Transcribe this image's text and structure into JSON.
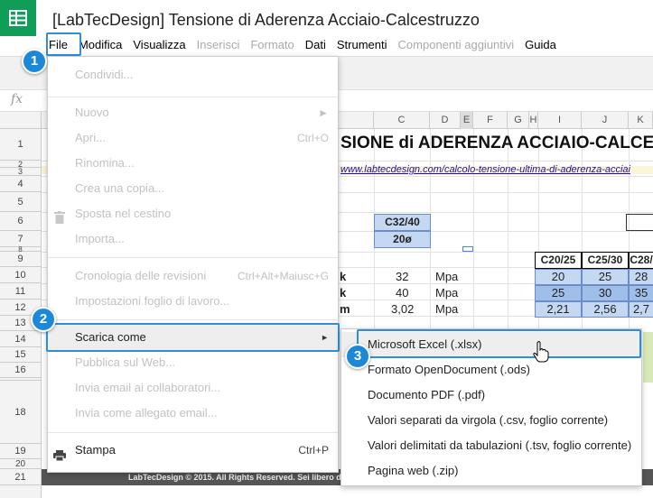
{
  "app": {
    "title": "[LabTecDesign] Tensione di Aderenza Acciaio-Calcestruzzo",
    "logo_icon": "sheets-grid-icon",
    "brand_color": "#0f9d58"
  },
  "menubar": {
    "items": [
      {
        "label": "File",
        "enabled": true
      },
      {
        "label": "Modifica",
        "enabled": true
      },
      {
        "label": "Visualizza",
        "enabled": true
      },
      {
        "label": "Inserisci",
        "enabled": false
      },
      {
        "label": "Formato",
        "enabled": false
      },
      {
        "label": "Dati",
        "enabled": true
      },
      {
        "label": "Strumenti",
        "enabled": true
      },
      {
        "label": "Componenti aggiuntivi",
        "enabled": false
      },
      {
        "label": "Guida",
        "enabled": true
      }
    ]
  },
  "formula_bar": {
    "icon_text": "fx"
  },
  "grid": {
    "columns": [
      "C",
      "D",
      "E",
      "F",
      "G",
      "H",
      "I",
      "J",
      "K"
    ],
    "rows": [
      "1",
      "2",
      "3",
      "4",
      "5",
      "6",
      "7",
      "8",
      "9",
      "10",
      "11",
      "12",
      "13",
      "14",
      "15",
      "16",
      "17",
      "18",
      "19",
      "20",
      "21"
    ],
    "heading": "SIONE di ADERENZA ACCIAIO-CALCES",
    "link": "www.labtecdesign.com/calcolo-tensione-ultima-di-aderenza-acciai",
    "concrete_class": "C32/40",
    "bar_diameter": "20ø",
    "param_rows": [
      {
        "label": "k",
        "value": "32",
        "unit": "Mpa"
      },
      {
        "label": "k",
        "value": "40",
        "unit": "Mpa"
      },
      {
        "label": "m",
        "value": "3,02",
        "unit": "Mpa"
      }
    ],
    "table_headers": [
      "C20/25",
      "C25/30",
      "C28/"
    ],
    "table_rows": [
      [
        "20",
        "25",
        "28"
      ],
      [
        "25",
        "30",
        "35"
      ],
      [
        "2,21",
        "2,56",
        "2,7"
      ]
    ],
    "footer_text": "LabTecDesign © 2015. All Rights Reserved. Sei libero di"
  },
  "file_menu": {
    "items": [
      {
        "label": "Condividi...",
        "shortcut": "",
        "enabled": false
      },
      {
        "label": "Nuovo",
        "shortcut": "►",
        "enabled": false
      },
      {
        "label": "Apri...",
        "shortcut": "Ctrl+O",
        "enabled": false
      },
      {
        "label": "Rinomina...",
        "shortcut": "",
        "enabled": false
      },
      {
        "label": "Crea una copia...",
        "shortcut": "",
        "enabled": false
      },
      {
        "label": "Sposta nel cestino",
        "shortcut": "",
        "enabled": false,
        "icon": "trash-icon"
      },
      {
        "label": "Importa...",
        "shortcut": "",
        "enabled": false
      },
      {
        "label": "Cronologia delle revisioni",
        "shortcut": "Ctrl+Alt+Maiusc+G",
        "enabled": false
      },
      {
        "label": "Impostazioni foglio di lavoro...",
        "shortcut": "",
        "enabled": false
      },
      {
        "label": "Scarica come",
        "shortcut": "►",
        "enabled": true
      },
      {
        "label": "Pubblica sul Web...",
        "shortcut": "",
        "enabled": false
      },
      {
        "label": "Invia email ai collaboratori...",
        "shortcut": "",
        "enabled": false
      },
      {
        "label": "Invia come allegato email...",
        "shortcut": "",
        "enabled": false
      },
      {
        "label": "Stampa",
        "shortcut": "Ctrl+P",
        "enabled": true,
        "icon": "printer-icon"
      }
    ]
  },
  "download_submenu": {
    "items": [
      "Microsoft Excel (.xlsx)",
      "Formato OpenDocument (.ods)",
      "Documento PDF (.pdf)",
      "Valori separati da virgola (.csv, foglio corrente)",
      "Valori delimitati da tabulazioni (.tsv, foglio corrente)",
      "Pagina web (.zip)"
    ]
  },
  "badges": [
    "1",
    "2",
    "3"
  ],
  "colors": {
    "highlight": "#2f8fd6",
    "badge": "#1e88d8",
    "menu_hover": "#eeeeee"
  }
}
